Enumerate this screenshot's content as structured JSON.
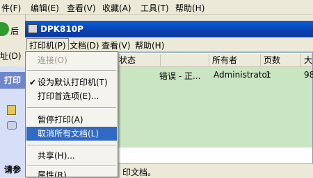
{
  "background_window": {
    "menu": [
      "件(F)",
      "编辑(E)",
      "查看(V)",
      "收藏(A)",
      "工具(T)",
      "帮助(H)"
    ],
    "back_label": "后",
    "address_label": "址(D)",
    "task_title": "打印",
    "bottom_label": "请参"
  },
  "printer_window": {
    "title": "DPK810P",
    "menu": [
      {
        "label": "打印机(P)",
        "active": true
      },
      {
        "label": "文档(D)",
        "active": false
      },
      {
        "label": "查看(V)",
        "active": false
      },
      {
        "label": "帮助(H)",
        "active": false
      }
    ],
    "columns": [
      "状态",
      "所有者",
      "页数",
      "大"
    ],
    "job": {
      "status": "错误 - 正...",
      "owner": "Administrator",
      "pages": "1",
      "size": "98"
    },
    "status_text": "印文档。"
  },
  "printer_menu": {
    "items": [
      {
        "label": "连接(O)",
        "disabled": true,
        "checked": false,
        "highlight": false
      },
      {
        "separator": true
      },
      {
        "label": "设为默认打印机(T)",
        "disabled": false,
        "checked": true,
        "highlight": false
      },
      {
        "label": "打印首选项(E)...",
        "disabled": false,
        "checked": false,
        "highlight": false
      },
      {
        "separator": true
      },
      {
        "label": "暂停打印(A)",
        "disabled": false,
        "checked": false,
        "highlight": false
      },
      {
        "label": "取消所有文档(L)",
        "disabled": false,
        "checked": false,
        "highlight": true
      },
      {
        "separator": true
      },
      {
        "label": "共享(H)...",
        "disabled": false,
        "checked": false,
        "highlight": false
      },
      {
        "separator": true
      },
      {
        "label": "属性(R)",
        "disabled": false,
        "checked": false,
        "highlight": false
      }
    ]
  },
  "colors": {
    "title_bar": "#0a4fc6",
    "job_row": "#c9e5c1",
    "highlight": "#316ac5"
  }
}
